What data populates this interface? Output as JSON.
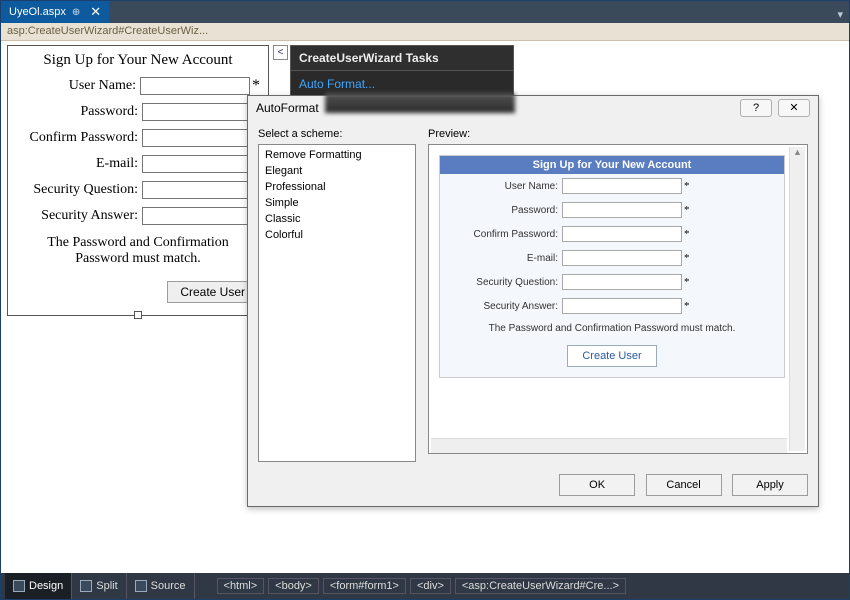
{
  "tab": {
    "filename": "UyeOl.aspx",
    "pin_icon": "⊕",
    "close_icon": "✕",
    "dropdown_icon": "▾"
  },
  "crumb": "asp:CreateUserWizard#CreateUserWiz...",
  "wizard": {
    "header": "Sign Up for Your New Account",
    "labels": {
      "username": "User Name:",
      "password": "Password:",
      "confirm": "Confirm Password:",
      "email": "E-mail:",
      "question": "Security Question:",
      "answer": "Security Answer:"
    },
    "asterisk": "*",
    "msg": "The Password and Confirmation Password must match.",
    "button": "Create User"
  },
  "tasks": {
    "title": "CreateUserWizard Tasks",
    "autoformat": "Auto Format..."
  },
  "smart_arrow": "<",
  "dialog": {
    "title": "AutoFormat",
    "help_icon": "?",
    "close_icon": "✕",
    "scheme_label": "Select a scheme:",
    "preview_label": "Preview:",
    "schemes": [
      "Remove Formatting",
      "Elegant",
      "Professional",
      "Simple",
      "Classic",
      "Colorful"
    ],
    "buttons": {
      "ok": "OK",
      "cancel": "Cancel",
      "apply": "Apply"
    }
  },
  "preview": {
    "header": "Sign Up for Your New Account",
    "labels": {
      "username": "User Name:",
      "password": "Password:",
      "confirm": "Confirm Password:",
      "email": "E-mail:",
      "question": "Security Question:",
      "answer": "Security Answer:"
    },
    "asterisk": "*",
    "msg": "The Password and Confirmation Password must match.",
    "button": "Create User"
  },
  "statusbar": {
    "views": {
      "design": "Design",
      "split": "Split",
      "source": "Source"
    },
    "path": [
      "<html>",
      "<body>",
      "<form#form1>",
      "<div>",
      "<asp:CreateUserWizard#Cre...>"
    ]
  }
}
